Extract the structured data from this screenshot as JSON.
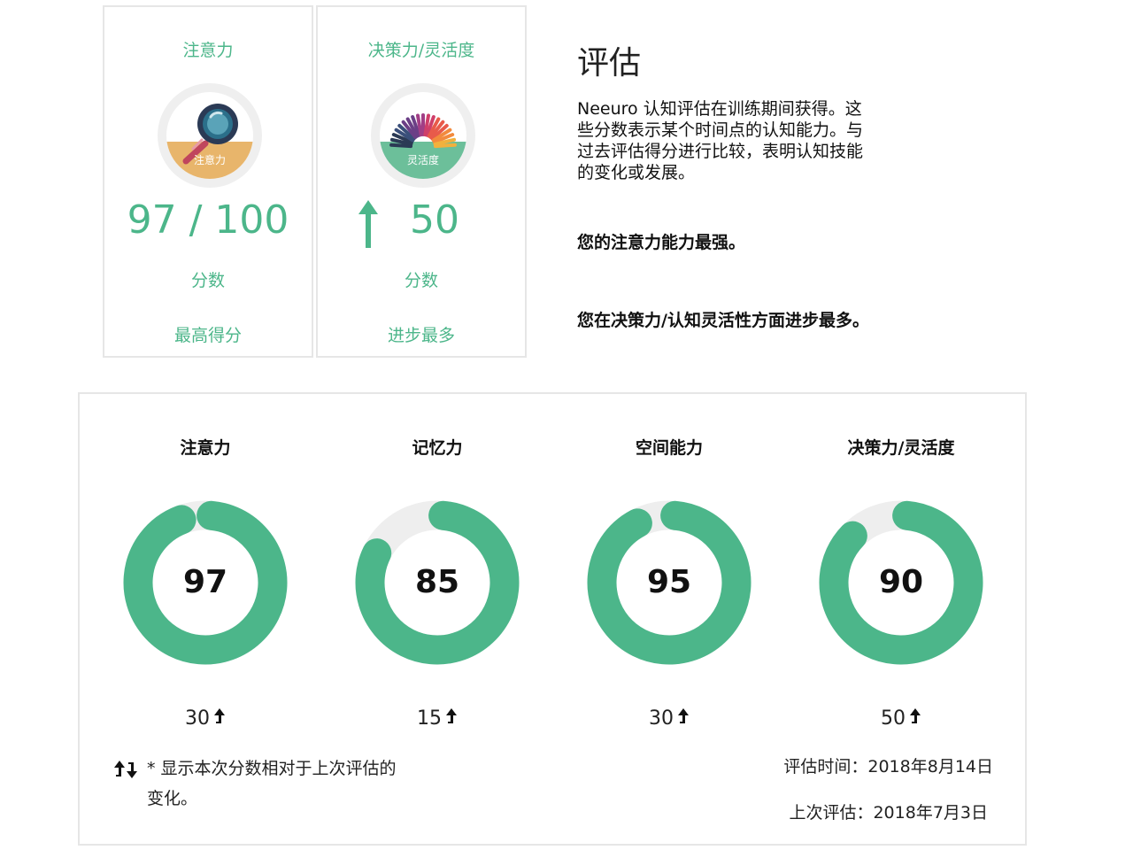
{
  "highlights": [
    {
      "title": "注意力",
      "badge_label": "注意力",
      "score": "97 / 100",
      "score_label": "分数",
      "footer": "最高得分"
    },
    {
      "title": "决策力/灵活度",
      "badge_label": "灵活度",
      "score": "50",
      "score_label": "分数",
      "footer": "进步最多"
    }
  ],
  "evaluation": {
    "title": "评估",
    "description": "Neeuro 认知评估在训练期间获得。这些分数表示某个时间点的认知能力。与过去评估得分进行比较，表明认知技能的变化或发展。",
    "strongest": "您的注意力能力最强。",
    "most_improved": "您在决策力/认知灵活性方面进步最多。"
  },
  "metrics": [
    {
      "name": "注意力",
      "score": 97,
      "score_text": "97",
      "delta": "30"
    },
    {
      "name": "记忆力",
      "score": 85,
      "score_text": "85",
      "delta": "15"
    },
    {
      "name": "空间能力",
      "score": 95,
      "score_text": "95",
      "delta": "30"
    },
    {
      "name": "决策力/灵活度",
      "score": 90,
      "score_text": "90",
      "delta": "50"
    }
  ],
  "legend": {
    "text": "* 显示本次分数相对于上次评估的变化。"
  },
  "dates": {
    "current": "评估时间：2018年8月14日",
    "previous": "上次评估：2018年7月3日"
  },
  "colors": {
    "accent": "#4cb68a",
    "attention_band": "#e8b56b",
    "flex_band": "#6cbf9a",
    "track": "#eeeeee"
  },
  "icons": {
    "attention": "magnifier-icon",
    "flexibility": "rainbow-fan-icon",
    "change": "up-down-arrows-icon"
  }
}
